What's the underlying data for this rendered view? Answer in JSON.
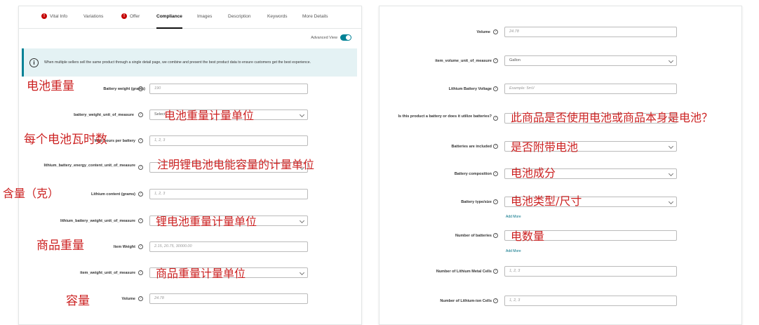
{
  "tabs": [
    {
      "label": "Vital Info",
      "error": true
    },
    {
      "label": "Variations",
      "error": false
    },
    {
      "label": "Offer",
      "error": true
    },
    {
      "label": "Compliance",
      "error": false,
      "active": true
    },
    {
      "label": "Images",
      "error": false
    },
    {
      "label": "Description",
      "error": false
    },
    {
      "label": "Keywords",
      "error": false
    },
    {
      "label": "More Details",
      "error": false
    }
  ],
  "advanced_view_label": "Advanced View",
  "info_text": "When multiple sellers sell the same product through a single detail page, we combine and present the best product data to ensure customers get the best experience.",
  "left_fields": [
    {
      "label": "Battery weight (grams)",
      "value": "190"
    },
    {
      "label": "battery_weight_unit_of_measure",
      "value": "Select"
    },
    {
      "label": "Watt hours per battery",
      "value": "1, 2, 3"
    },
    {
      "label": "lithium_battery_energy_content_unit_of_measure",
      "value": ""
    },
    {
      "label": "Lithium content (grams)",
      "value": "1, 2, 3"
    },
    {
      "label": "lithium_battery_weight_unit_of_measure",
      "value": ""
    },
    {
      "label": "Item Weight",
      "value": "2.15, 20.75, 30000.00"
    },
    {
      "label": "item_weight_unit_of_measure",
      "value": ""
    },
    {
      "label": "Volume",
      "value": "24.78"
    }
  ],
  "right_fields": [
    {
      "label": "Volume",
      "value": "24.78"
    },
    {
      "label": "item_volume_unit_of_measure",
      "value": "Gallon"
    },
    {
      "label": "Lithium Battery Voltage",
      "value": "Example: 5mV"
    },
    {
      "label": "Is this product a battery or does it utilize batteries?",
      "value": ""
    },
    {
      "label": "Batteries are included",
      "value": ""
    },
    {
      "label": "Battery composition",
      "value": ""
    },
    {
      "label": "Battery type/size",
      "value": ""
    },
    {
      "label": "Number of batteries",
      "value": ""
    },
    {
      "label": "Number of Lithium Metal Cells",
      "value": "1, 2, 3"
    },
    {
      "label": "Number of Lithium-ion Cells",
      "value": "1, 2, 3"
    }
  ],
  "add_more_label": "Add More",
  "annotations_left": [
    "电池重量",
    "电池重量计量单位",
    "每个电池瓦时数",
    "注明锂电池电能容量的计量单位",
    "含量（克）",
    "锂电池重量计量单位",
    "商品重量",
    "商品重量计量单位",
    "容量"
  ],
  "annotations_right": [
    "此商品是否使用电池或商品本身是电池？",
    "是否附带电池",
    "电池成分",
    "电池类型/尺寸",
    "电数量"
  ],
  "colors": {
    "accent": "#008296",
    "error": "#c40000",
    "annotation": "#cc2222",
    "info_bg": "#e4f2f4"
  }
}
